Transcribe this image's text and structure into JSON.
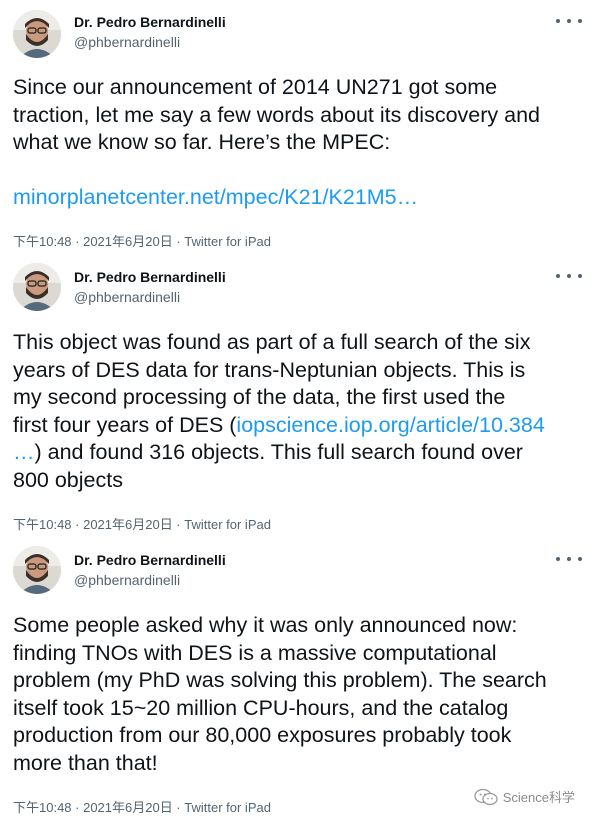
{
  "author": {
    "name": "Dr. Pedro Bernardinelli",
    "handle": "@phbernardinelli"
  },
  "tweets": [
    {
      "lines": [
        "Since our announcement of 2014 UN271 got some",
        "traction, let me say a few words about its discovery and",
        "what we know so far. Here’s the MPEC:"
      ],
      "link": "minorplanetcenter.net/mpec/K21/K21M5…",
      "meta": "下午10:48 · 2021年6月20日 · ",
      "source": "Twitter for iPad"
    },
    {
      "lines": [
        "This object was found as part of a full search of the six",
        "years of DES data for trans-Neptunian objects. This is",
        "my second processing of the data, the first used the"
      ],
      "line4_prefix": "first four years of DES (",
      "link_part1": "iopscience.iop.org/article/10.384",
      "link_part2": "…",
      "line5_suffix": ") and found 316 objects. This full search found over",
      "line6": "800 objects",
      "meta": "下午10:48 · 2021年6月20日 · ",
      "source": "Twitter for iPad"
    },
    {
      "lines": [
        "Some people asked why it was only announced now:",
        "finding TNOs with DES is a massive computational",
        "problem (my PhD was solving this problem). The search",
        "itself took 15~20 million CPU-hours, and the catalog",
        "production from our 80,000 exposures probably took",
        "more than that!"
      ],
      "meta": "下午10:48 · 2021年6月20日 · ",
      "source": "Twitter for iPad"
    }
  ],
  "watermark": {
    "text": "Science科学",
    "icon": "wechat-icon"
  },
  "colors": {
    "link": "#1d9bf0",
    "secondary_text": "#536471",
    "primary_text": "#0f1419"
  }
}
